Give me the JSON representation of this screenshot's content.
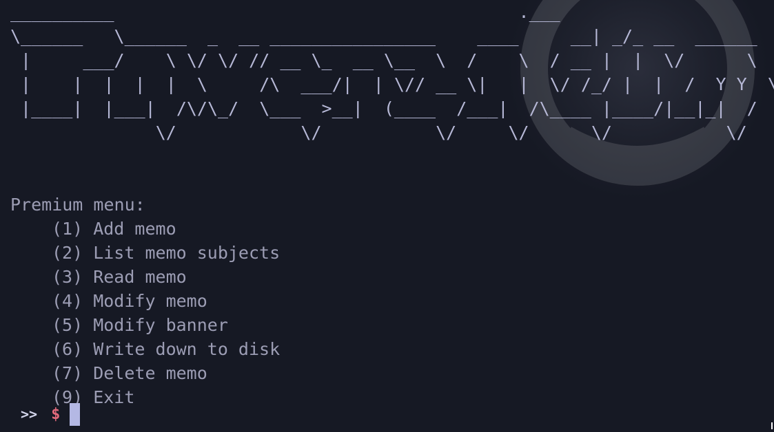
{
  "banner": {
    "lines": [
      "__________                                       .___",
      "\\______   \\______  _  __ ________________    ____     __| _/_ __  ______",
      " |     ___/    \\ \\/ \\/ // __ \\_  __ \\__  \\  /    \\  / __ |  |  \\/      \\",
      " |    |  |  |  |  \\     /\\  ___/|  | \\// __ \\|   |  \\/ /_/ |  |  /  Y Y  \\",
      " |____|  |___|  /\\/\\_/  \\___  >__|  (____  /___|  /\\____ |____/|__|_|  /",
      "              \\/            \\/           \\/     \\/      \\/           \\/"
    ]
  },
  "menu": {
    "title": "Premium menu:",
    "items": [
      "(1) Add memo",
      "(2) List memo subjects",
      "(3) Read memo",
      "(4) Modify memo",
      "(5) Modify banner",
      "(6) Write down to disk",
      "(7) Delete memo",
      "(9) Exit"
    ]
  },
  "prompt": {
    "arrows": ">>",
    "symbol": "$",
    "value": ""
  },
  "colors": {
    "background": "#161924",
    "text": "#9c9db4",
    "banner_text": "#b6b8d6",
    "prompt_symbol": "#e26a7c",
    "cursor": "#b4b8e4"
  }
}
